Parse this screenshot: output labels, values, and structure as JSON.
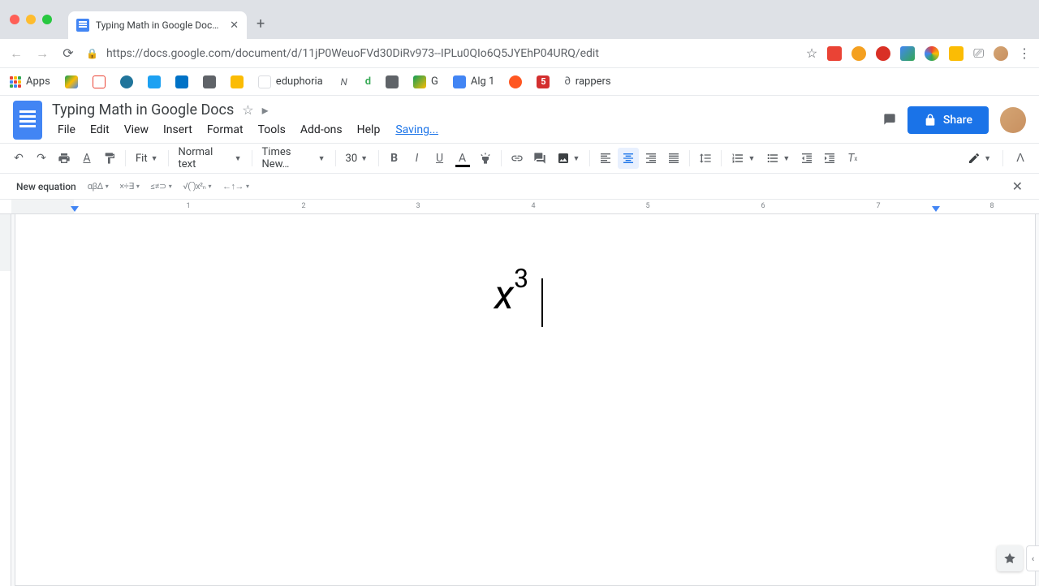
{
  "window": {
    "tab_title": "Typing Math in Google Docs - G"
  },
  "browser": {
    "url": "https://docs.google.com/document/d/11jP0WeuoFVd30DiRv973--IPLu0QIo6Q5JYEhP04URQ/edit",
    "bookmarks": {
      "apps": "Apps",
      "eduphoria": "eduphoria",
      "d": "d",
      "g": "G",
      "alg1": "Alg 1",
      "rappers": "rappers"
    }
  },
  "docs": {
    "title": "Typing Math in Google Docs",
    "status": "Saving...",
    "menu": {
      "file": "File",
      "edit": "Edit",
      "view": "View",
      "insert": "Insert",
      "format": "Format",
      "tools": "Tools",
      "addons": "Add-ons",
      "help": "Help"
    },
    "share": "Share",
    "toolbar": {
      "zoom": "Fit",
      "style": "Normal text",
      "font": "Times New…",
      "size": "30"
    },
    "equation": {
      "label": "New equation",
      "greek": "αβΔ",
      "ops": "×÷∃",
      "rel": "≤≠⊃",
      "math": "√(‾)x²ₙ",
      "arrows": "←↑→"
    }
  },
  "ruler": {
    "ticks": [
      "1",
      "2",
      "3",
      "4",
      "5",
      "6",
      "7",
      "8"
    ]
  },
  "content": {
    "base": "x",
    "exponent": "3"
  }
}
